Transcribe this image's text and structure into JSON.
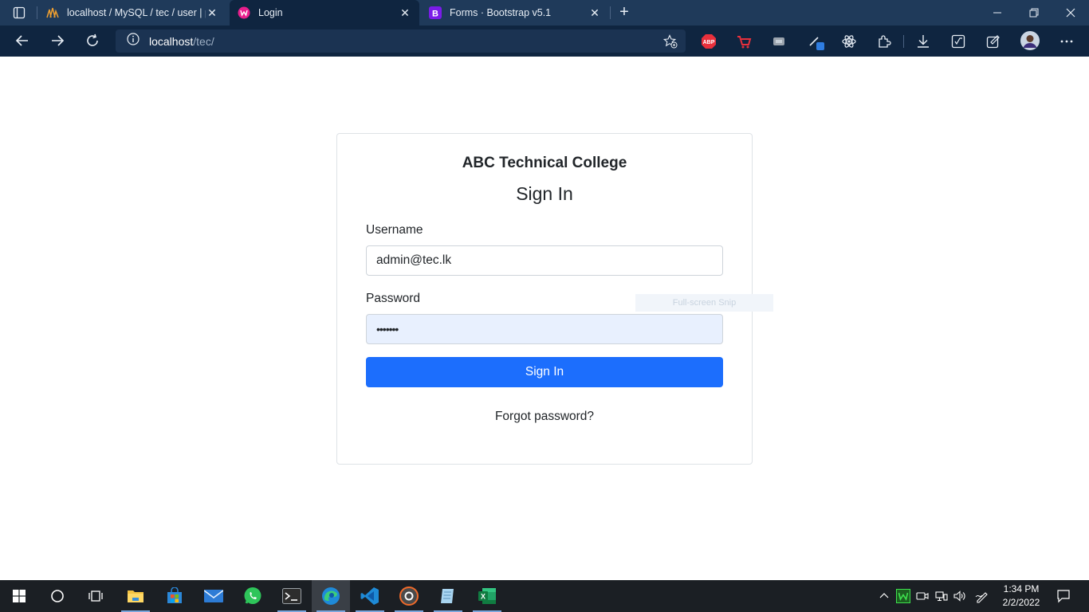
{
  "browser": {
    "tabs": [
      {
        "label": "localhost / MySQL / tec / user | p",
        "icon": "phpmyadmin-icon",
        "active": false
      },
      {
        "label": "Login",
        "icon": "wamp-icon",
        "active": true
      },
      {
        "label": "Forms · Bootstrap v5.1",
        "icon": "bootstrap-icon",
        "active": false
      }
    ],
    "address": {
      "host": "localhost",
      "path": "/tec/"
    },
    "extensions": [
      "adblock-plus-icon",
      "cart-icon",
      "screen-icon",
      "color-picker-icon",
      "react-devtools-icon",
      "extensions-icon",
      "downloads-icon",
      "math-solver-icon",
      "screenshot-icon",
      "profile-avatar",
      "more-icon"
    ]
  },
  "page": {
    "college": "ABC Technical College",
    "title": "Sign In",
    "username_label": "Username",
    "username_value": "admin@tec.lk",
    "password_label": "Password",
    "password_value": "•••••••",
    "submit_label": "Sign In",
    "forgot_label": "Forgot password?",
    "snip_label": "Full-screen Snip"
  },
  "taskbar": {
    "apps": [
      "windows-start-icon",
      "search-icon",
      "task-view-icon",
      "file-explorer-icon",
      "microsoft-store-icon",
      "mail-icon",
      "whatsapp-icon",
      "terminal-icon",
      "edge-icon",
      "vscode-icon",
      "davinci-icon",
      "notepad-icon",
      "excel-icon"
    ],
    "time": "1:34 PM",
    "date": "2/2/2022"
  },
  "colors": {
    "tabbar": "#1f3a5a",
    "toolbar": "#0f2540",
    "primary": "#1c6efd",
    "autofill": "#e8f0fe"
  }
}
